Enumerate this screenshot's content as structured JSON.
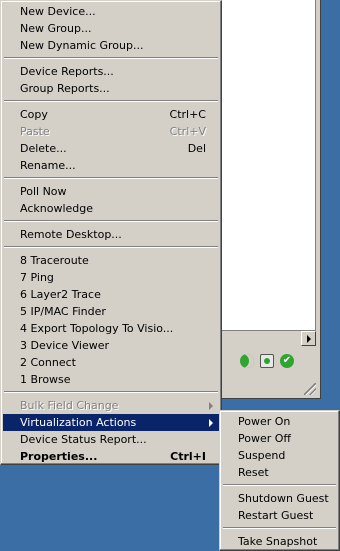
{
  "context_menu": {
    "new_device": "New Device...",
    "new_group": "New Group...",
    "new_dynamic_group": "New Dynamic Group...",
    "device_reports": "Device Reports...",
    "group_reports": "Group Reports...",
    "copy": "Copy",
    "copy_accel": "Ctrl+C",
    "paste": "Paste",
    "paste_accel": "Ctrl+V",
    "delete": "Delete...",
    "delete_accel": "Del",
    "rename": "Rename...",
    "poll_now": "Poll Now",
    "acknowledge": "Acknowledge",
    "remote_desktop": "Remote Desktop...",
    "tools": [
      {
        "key": "8",
        "label": "Traceroute"
      },
      {
        "key": "7",
        "label": "Ping"
      },
      {
        "key": "6",
        "label": "Layer2 Trace"
      },
      {
        "key": "5",
        "label": "IP/MAC Finder"
      },
      {
        "key": "4",
        "label": "Export Topology To Visio..."
      },
      {
        "key": "3",
        "label": "Device Viewer"
      },
      {
        "key": "2",
        "label": "Connect"
      },
      {
        "key": "1",
        "label": "Browse"
      }
    ],
    "bulk_field_change": "Bulk Field Change",
    "virtualization_actions": "Virtualization Actions",
    "device_status_report": "Device Status Report...",
    "properties": "Properties...",
    "properties_accel": "Ctrl+I"
  },
  "virtualization_submenu": {
    "power_on": "Power On",
    "power_off": "Power Off",
    "suspend": "Suspend",
    "reset": "Reset",
    "shutdown_guest": "Shutdown Guest",
    "restart_guest": "Restart Guest",
    "take_snapshot": "Take Snapshot"
  },
  "colors": {
    "desktop": "#3a6ea5",
    "menu_face": "#d4d0c8",
    "highlight": "#0a246a",
    "disabled_text": "#808080"
  },
  "status_icons": [
    "moon-status-icon",
    "recycle-bin-icon",
    "green-check-icon"
  ]
}
